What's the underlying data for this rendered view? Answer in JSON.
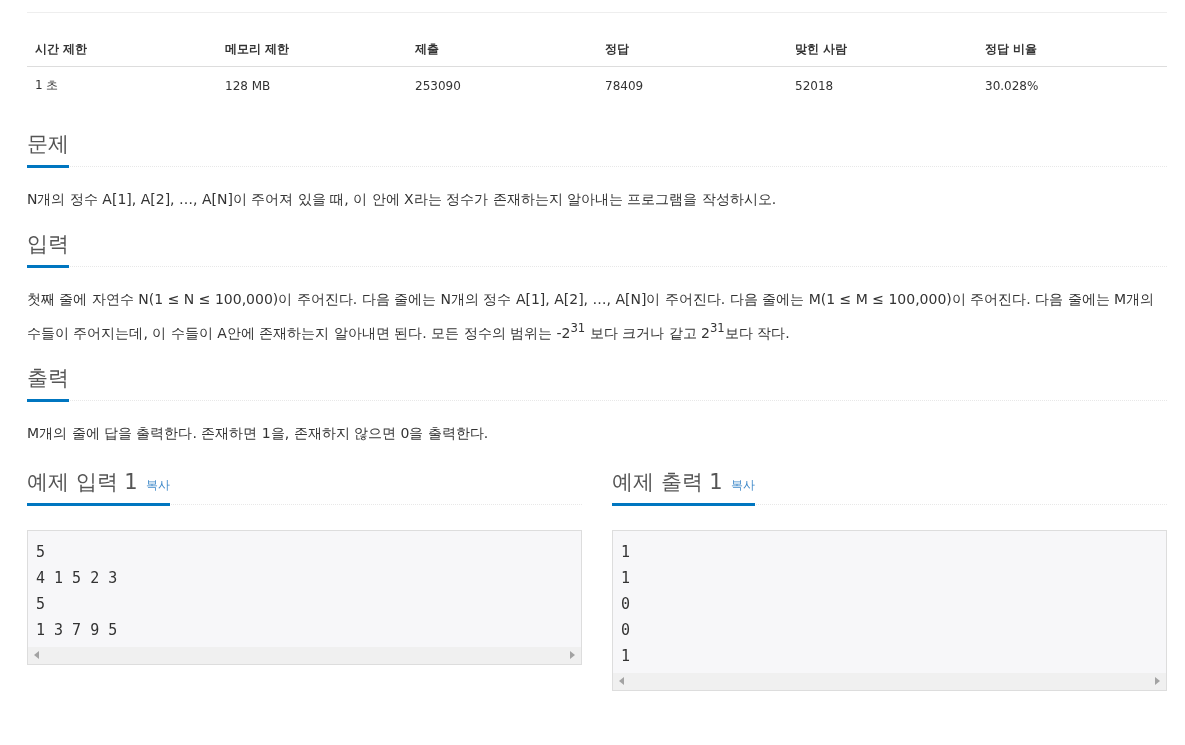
{
  "info_table": {
    "columns": [
      "시간 제한",
      "메모리 제한",
      "제출",
      "정답",
      "맞힌 사람",
      "정답 비율"
    ],
    "rows": [
      [
        "1 초",
        "128 MB",
        "253090",
        "78409",
        "52018",
        "30.028%"
      ]
    ]
  },
  "sections": [
    {
      "title": "문제",
      "text": "N개의 정수 A[1], A[2], …, A[N]이 주어져 있을 때, 이 안에 X라는 정수가 존재하는지 알아내는 프로그램을 작성하시오."
    },
    {
      "title": "입력",
      "text": "첫째 줄에 자연수 N(1 ≤ N ≤ 100,000)이 주어진다. 다음 줄에는 N개의 정수 A[1], A[2], …, A[N]이 주어진다. 다음 줄에는 M(1 ≤ M ≤ 100,000)이 주어진다. 다음 줄에는 M개의 수들이 주어지는데, 이 수들이 A안에 존재하는지 알아내면 된다. 모든 정수의 범위는 -2$^{31}$ 보다 크거나 같고 2$^{31}$보다 작다."
    },
    {
      "title": "출력",
      "text": "M개의 줄에 답을 출력한다. 존재하면 1을, 존재하지 않으면 0을 출력한다."
    }
  ],
  "samples": [
    {
      "title": "예제 입력 1",
      "copy": "복사",
      "text": "5\n4 1 5 2 3\n5\n1 3 7 9 5"
    },
    {
      "title": "예제 출력 1",
      "copy": "복사",
      "text": "1\n1\n0\n0\n1"
    }
  ]
}
